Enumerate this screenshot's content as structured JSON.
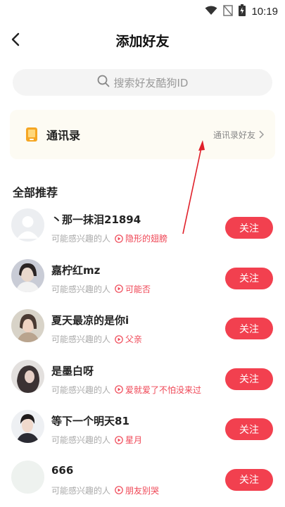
{
  "status": {
    "time": "10:19"
  },
  "header": {
    "title": "添加好友"
  },
  "search": {
    "placeholder": "搜索好友酷狗ID"
  },
  "contacts": {
    "label": "通讯录",
    "link_label": "通讯录好友"
  },
  "section": {
    "title": "全部推荐"
  },
  "colors": {
    "accent": "#f2404f",
    "song": "#ef4655",
    "card_bg": "#fdfbf3",
    "arrow": "#e0202a"
  },
  "recommendations": [
    {
      "name": "丶那一抹泪21894",
      "reason": "可能感兴趣的人",
      "song": "隐形的翅膀",
      "button": "关注",
      "avatar": "default-avatar"
    },
    {
      "name": "嘉柠红mz",
      "reason": "可能感兴趣的人",
      "song": "可能否",
      "button": "关注",
      "avatar": "photo-avatar"
    },
    {
      "name": "夏天最凉的是你i",
      "reason": "可能感兴趣的人",
      "song": "父亲",
      "button": "关注",
      "avatar": "photo-avatar"
    },
    {
      "name": "是墨白呀",
      "reason": "可能感兴趣的人",
      "song": "爱就爱了不怕没来过",
      "button": "关注",
      "avatar": "photo-avatar"
    },
    {
      "name": "等下一个明天81",
      "reason": "可能感兴趣的人",
      "song": "星月",
      "button": "关注",
      "avatar": "photo-avatar"
    },
    {
      "name": "666",
      "reason": "可能感兴趣的人",
      "song": "朋友别哭",
      "button": "关注",
      "avatar": "blank-avatar"
    }
  ]
}
